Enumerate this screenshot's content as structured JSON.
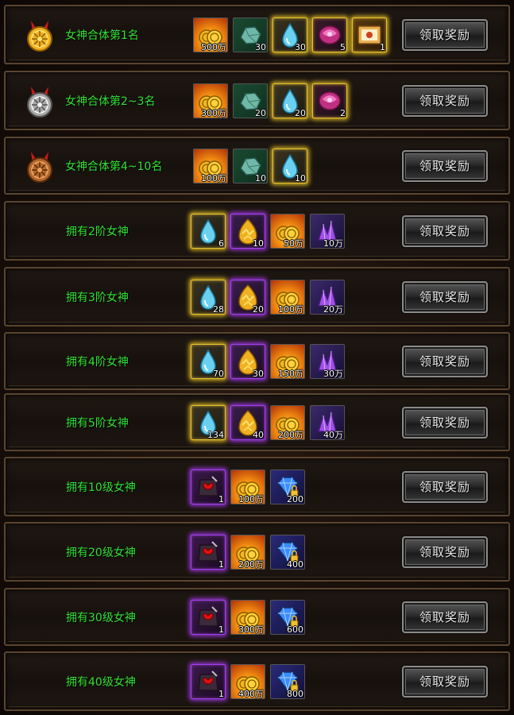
{
  "button_label": "领取奖励",
  "rows": [
    {
      "label": "女神合体第1名",
      "medal": "gold-medal-icon",
      "items": [
        {
          "icon": "coin-icon",
          "qty": "500万"
        },
        {
          "icon": "green-stone-icon",
          "qty": "30"
        },
        {
          "icon": "water-drop-icon",
          "qty": "30"
        },
        {
          "icon": "pink-orb-icon",
          "qty": "5"
        },
        {
          "icon": "scroll-book-icon",
          "qty": "1"
        }
      ]
    },
    {
      "label": "女神合体第2~3名",
      "medal": "silver-medal-icon",
      "items": [
        {
          "icon": "coin-icon",
          "qty": "300万"
        },
        {
          "icon": "green-stone-icon",
          "qty": "20"
        },
        {
          "icon": "water-drop-icon",
          "qty": "20"
        },
        {
          "icon": "pink-orb-icon",
          "qty": "2"
        }
      ]
    },
    {
      "label": "女神合体第4~10名",
      "medal": "bronze-medal-icon",
      "items": [
        {
          "icon": "coin-icon",
          "qty": "100万"
        },
        {
          "icon": "green-stone-icon",
          "qty": "10"
        },
        {
          "icon": "water-drop-icon",
          "qty": "10"
        }
      ]
    },
    {
      "label": "拥有2阶女神",
      "items": [
        {
          "icon": "water-drop-icon",
          "qty": "6"
        },
        {
          "icon": "golden-egg-icon",
          "qty": "10"
        },
        {
          "icon": "coin-icon",
          "qty": "50万"
        },
        {
          "icon": "purple-crystal-icon",
          "qty": "10万"
        }
      ]
    },
    {
      "label": "拥有3阶女神",
      "items": [
        {
          "icon": "water-drop-icon",
          "qty": "28"
        },
        {
          "icon": "golden-egg-icon",
          "qty": "20"
        },
        {
          "icon": "coin-icon",
          "qty": "100万"
        },
        {
          "icon": "purple-crystal-icon",
          "qty": "20万"
        }
      ]
    },
    {
      "label": "拥有4阶女神",
      "items": [
        {
          "icon": "water-drop-icon",
          "qty": "70"
        },
        {
          "icon": "golden-egg-icon",
          "qty": "30"
        },
        {
          "icon": "coin-icon",
          "qty": "150万"
        },
        {
          "icon": "purple-crystal-icon",
          "qty": "30万"
        }
      ]
    },
    {
      "label": "拥有5阶女神",
      "items": [
        {
          "icon": "water-drop-icon",
          "qty": "134"
        },
        {
          "icon": "golden-egg-icon",
          "qty": "40"
        },
        {
          "icon": "coin-icon",
          "qty": "200万"
        },
        {
          "icon": "purple-crystal-icon",
          "qty": "40万"
        }
      ]
    },
    {
      "label": "拥有10级女神",
      "items": [
        {
          "icon": "armor-chest-icon",
          "qty": "1"
        },
        {
          "icon": "coin-icon",
          "qty": "100万"
        },
        {
          "icon": "locked-gem-icon",
          "qty": "200"
        }
      ]
    },
    {
      "label": "拥有20级女神",
      "items": [
        {
          "icon": "armor-chest-icon",
          "qty": "1"
        },
        {
          "icon": "coin-icon",
          "qty": "200万"
        },
        {
          "icon": "locked-gem-icon",
          "qty": "400"
        }
      ]
    },
    {
      "label": "拥有30级女神",
      "items": [
        {
          "icon": "armor-chest-icon",
          "qty": "1"
        },
        {
          "icon": "coin-icon",
          "qty": "300万"
        },
        {
          "icon": "locked-gem-icon",
          "qty": "600"
        }
      ]
    },
    {
      "label": "拥有40级女神",
      "items": [
        {
          "icon": "armor-chest-icon",
          "qty": "1"
        },
        {
          "icon": "coin-icon",
          "qty": "400万"
        },
        {
          "icon": "locked-gem-icon",
          "qty": "800"
        }
      ]
    }
  ]
}
